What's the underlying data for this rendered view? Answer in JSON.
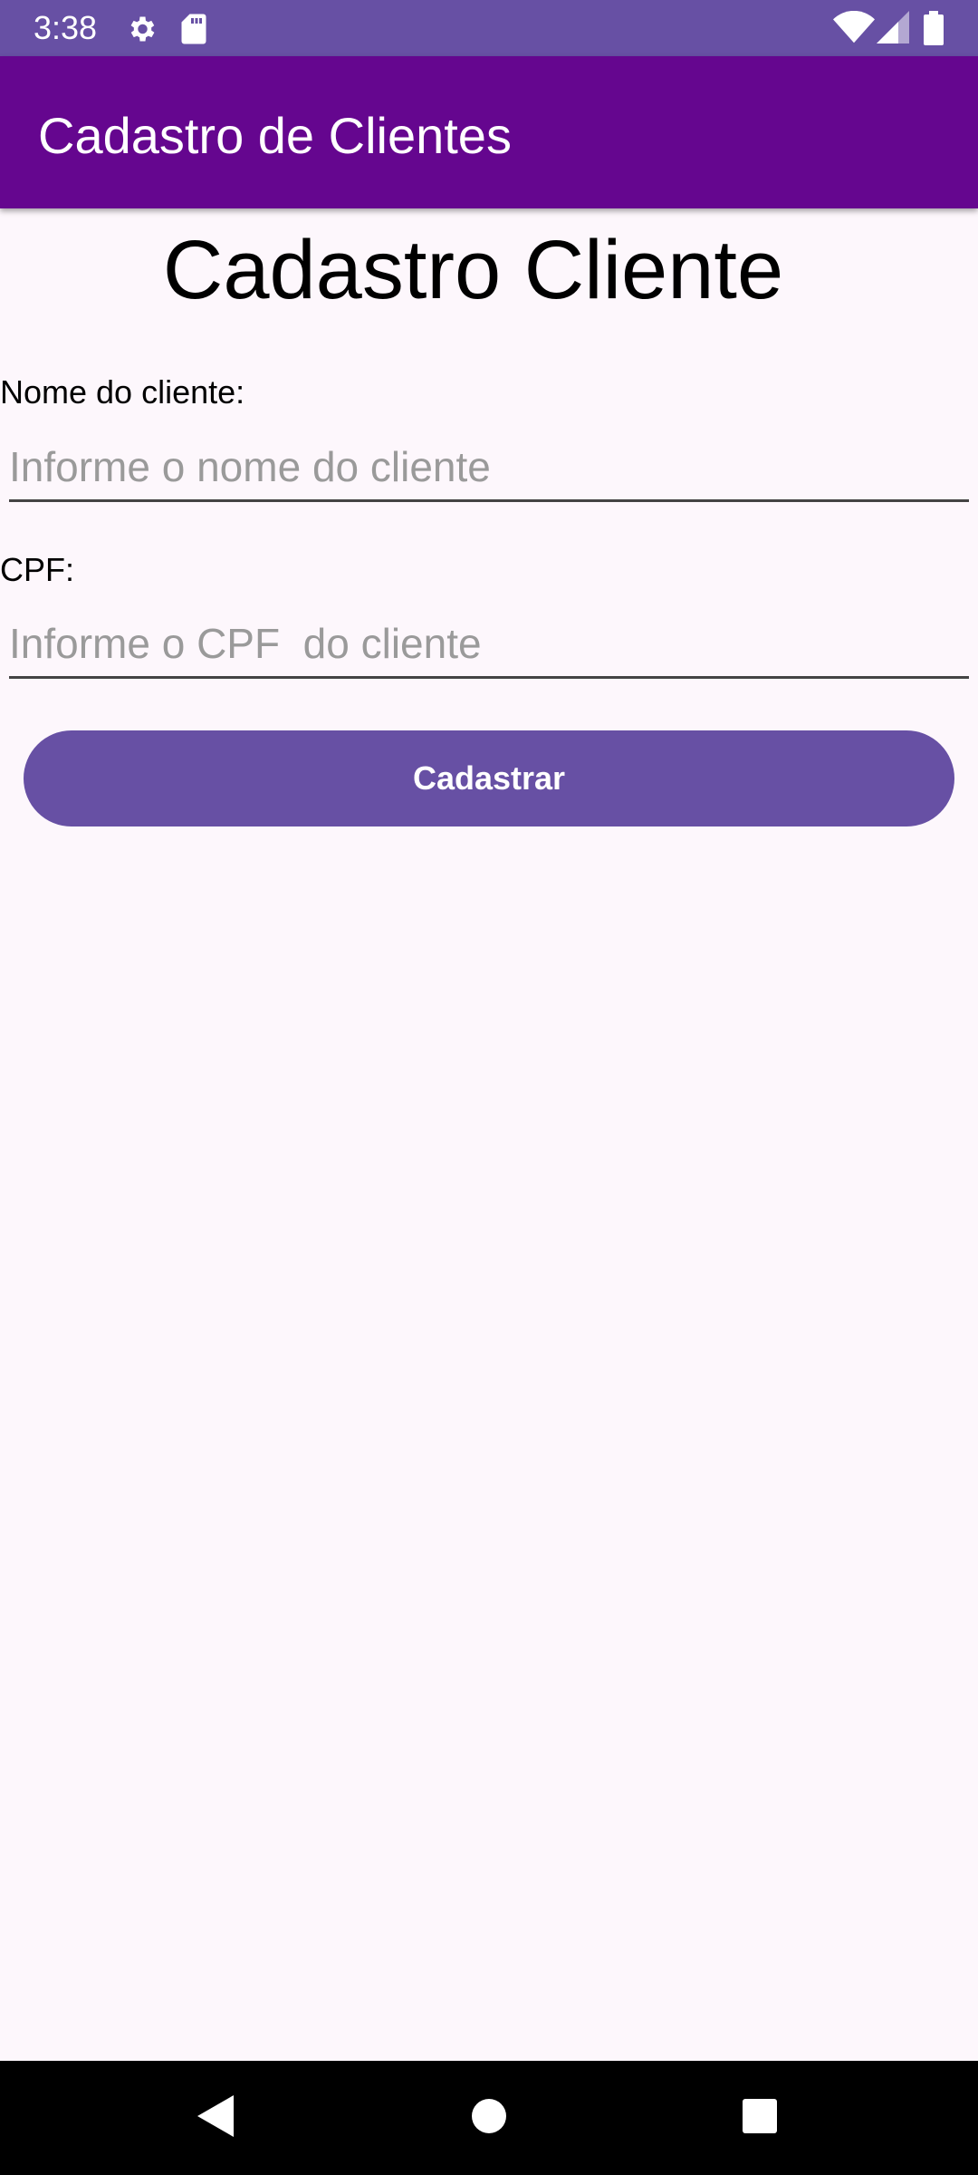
{
  "status_bar": {
    "time": "3:38",
    "icons": [
      "gear-icon",
      "sd-card-icon",
      "wifi-icon",
      "cell-signal-icon",
      "battery-icon"
    ]
  },
  "app_bar": {
    "title": "Cadastro de Clientes"
  },
  "form": {
    "heading": "Cadastro Cliente",
    "name_label": "Nome do cliente:",
    "name_placeholder": "Informe o nome do cliente",
    "name_value": "",
    "cpf_label": "CPF:",
    "cpf_placeholder": "Informe o CPF  do cliente",
    "cpf_value": "",
    "submit_label": "Cadastrar"
  },
  "nav_bar": {
    "icons": [
      "back-icon",
      "home-icon",
      "recents-icon"
    ]
  },
  "colors": {
    "status_bar": "#6750a4",
    "app_bar": "#65068f",
    "button": "#6750a4",
    "background": "#fdf7fc"
  }
}
